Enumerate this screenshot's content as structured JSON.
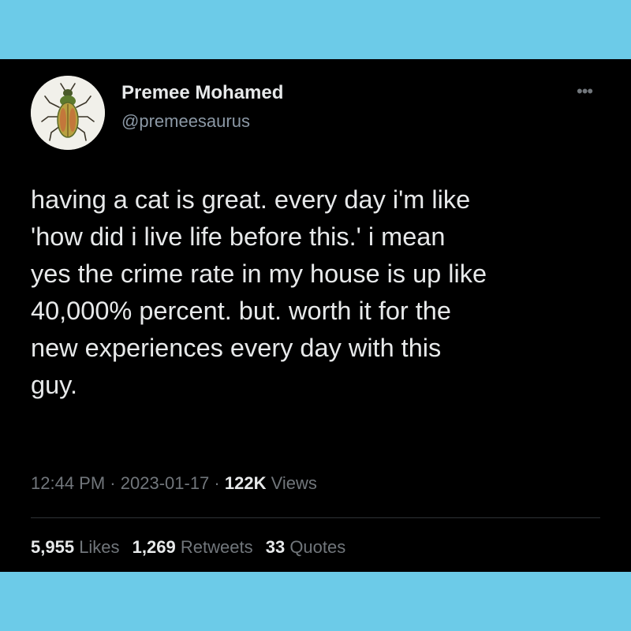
{
  "colors": {
    "page_background": "#6ccbe8",
    "card_background": "#000000",
    "primary_text": "#e7e9ea",
    "secondary_text": "#71767b"
  },
  "author": {
    "display_name": "Premee Mohamed",
    "handle": "@premeesaurus",
    "avatar_icon": "beetle-avatar-icon"
  },
  "more_icon": "more-horizontal-icon",
  "tweet": {
    "lines": [
      "having a cat is great. every day i'm like",
      "'how did i live life before this.' i mean",
      "yes the crime rate in my house is up like",
      "40,000% percent. but. worth it for the",
      "new experiences every day with this",
      "guy."
    ]
  },
  "meta": {
    "time": "12:44 PM",
    "separator": "·",
    "date": "2023-01-17",
    "views_count": "122K",
    "views_label": "Views"
  },
  "stats": {
    "likes_count": "5,955",
    "likes_label": "Likes",
    "retweets_count": "1,269",
    "retweets_label": "Retweets",
    "quotes_count": "33",
    "quotes_label": "Quotes"
  }
}
